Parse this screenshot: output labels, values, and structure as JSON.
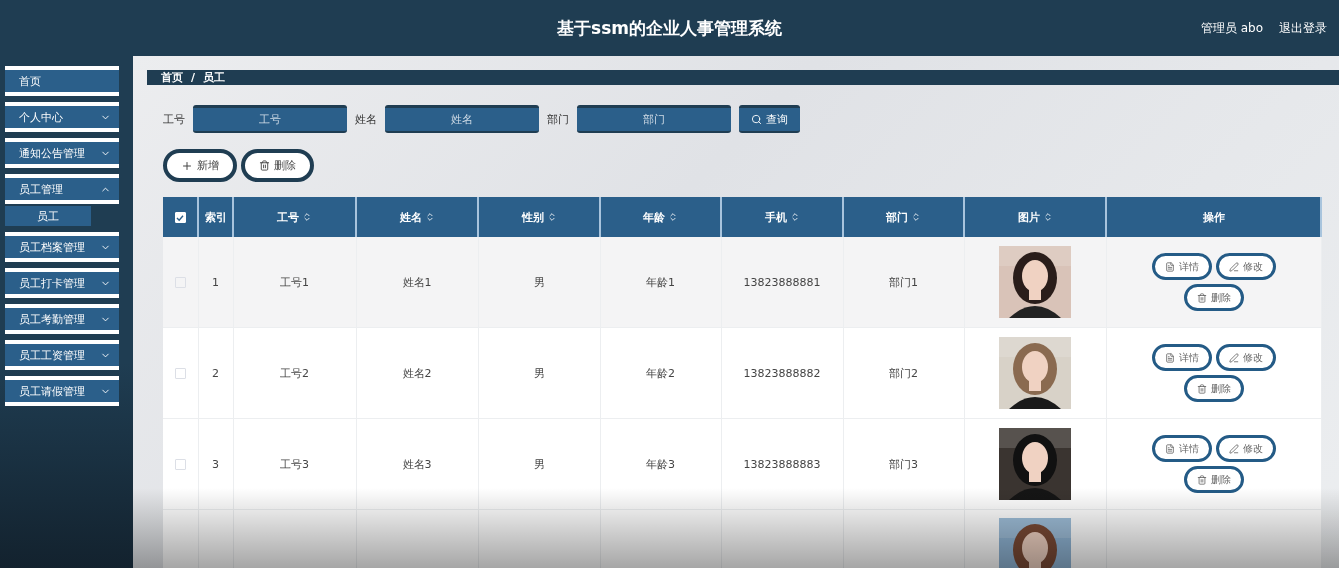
{
  "header": {
    "title": "基于ssm的企业人事管理系统",
    "user": "管理员 abo",
    "logout": "退出登录"
  },
  "sidebar": {
    "items": [
      {
        "label": "首页",
        "kind": "link"
      },
      {
        "label": "个人中心",
        "kind": "menu",
        "expanded": false
      },
      {
        "label": "通知公告管理",
        "kind": "menu",
        "expanded": false
      },
      {
        "label": "员工管理",
        "kind": "menu",
        "expanded": true,
        "children": [
          {
            "label": "员工",
            "selected": true
          }
        ]
      },
      {
        "label": "员工档案管理",
        "kind": "menu",
        "expanded": false
      },
      {
        "label": "员工打卡管理",
        "kind": "menu",
        "expanded": false
      },
      {
        "label": "员工考勤管理",
        "kind": "menu",
        "expanded": false
      },
      {
        "label": "员工工资管理",
        "kind": "menu",
        "expanded": false
      },
      {
        "label": "员工请假管理",
        "kind": "menu",
        "expanded": false
      }
    ]
  },
  "breadcrumb": [
    "首页",
    "/",
    "员工"
  ],
  "search": {
    "fields": [
      {
        "label": "工号",
        "placeholder": "工号"
      },
      {
        "label": "姓名",
        "placeholder": "姓名"
      },
      {
        "label": "部门",
        "placeholder": "部门"
      }
    ],
    "button": "查询"
  },
  "actions": [
    "新增",
    "删除"
  ],
  "table": {
    "select_all": {
      "checked": true
    },
    "columns": [
      {
        "label": "索引",
        "sortable": false
      },
      {
        "label": "工号",
        "sortable": true
      },
      {
        "label": "姓名",
        "sortable": true
      },
      {
        "label": "性别",
        "sortable": true
      },
      {
        "label": "年龄",
        "sortable": true
      },
      {
        "label": "手机",
        "sortable": true
      },
      {
        "label": "部门",
        "sortable": true
      },
      {
        "label": "图片",
        "sortable": true
      },
      {
        "label": "操作",
        "sortable": false
      }
    ],
    "rows": [
      {
        "checked": false,
        "cells": [
          "1",
          "工号1",
          "姓名1",
          "男",
          "年龄1",
          "13823888881",
          "部门1"
        ],
        "photo": {
          "kind": "picture"
        },
        "buttons": [
          "详情",
          "修改",
          "删除"
        ]
      },
      {
        "checked": false,
        "cells": [
          "2",
          "工号2",
          "姓名2",
          "男",
          "年龄2",
          "13823888882",
          "部门2"
        ],
        "photo": {
          "kind": "picture"
        },
        "buttons": [
          "详情",
          "修改",
          "删除"
        ]
      },
      {
        "checked": false,
        "cells": [
          "3",
          "工号3",
          "姓名3",
          "男",
          "年龄3",
          "13823888883",
          "部门3"
        ],
        "photo": {
          "kind": "picture"
        },
        "buttons": [
          "详情",
          "修改",
          "删除"
        ]
      },
      {
        "photo": {
          "kind": "picture"
        }
      }
    ]
  }
}
